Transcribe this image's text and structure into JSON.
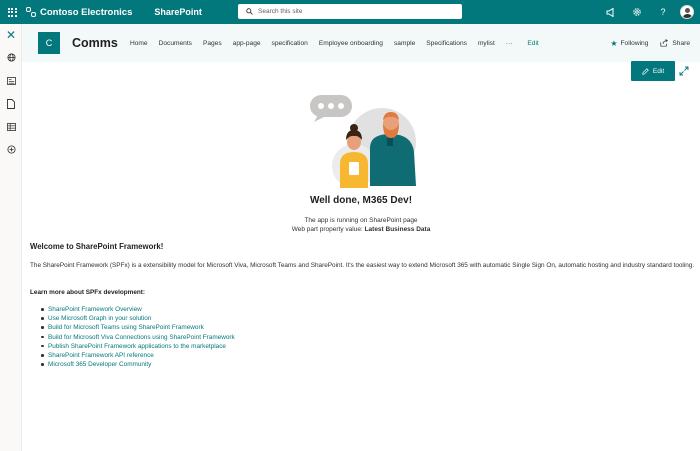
{
  "suite": {
    "org_name": "Contoso Electronics",
    "app_name": "SharePoint",
    "search_placeholder": "Search this site",
    "right_icons": [
      "megaphone-icon",
      "gear-icon",
      "help-icon"
    ],
    "help_glyph": "?"
  },
  "rail": {
    "items": [
      "close-icon",
      "globe-icon",
      "news-icon",
      "page-icon",
      "list-icon",
      "add-icon"
    ]
  },
  "site": {
    "logo_letter": "C",
    "title": "Comms",
    "nav": [
      "Home",
      "Documents",
      "Pages",
      "app-page",
      "specification",
      "Employee onboarding",
      "sample",
      "Specifications",
      "mylist"
    ],
    "more": "···",
    "edit_link": "Edit",
    "following": "Following",
    "share": "Share"
  },
  "command": {
    "edit_label": "Edit"
  },
  "webpart": {
    "greeting": "Well done, M365 Dev!",
    "env_line": "The app is running on SharePoint page",
    "prop_label": "Web part property value: ",
    "prop_value": "Latest Business Data",
    "welcome_heading": "Welcome to SharePoint Framework!",
    "description": "The SharePoint Framework (SPFx) is a extensibility model for Microsoft Viva, Microsoft Teams and SharePoint. It's the easiest way to extend Microsoft 365 with automatic Single Sign On, automatic hosting and industry standard tooling.",
    "learn_heading": "Learn more about SPFx development:",
    "links": [
      "SharePoint Framework Overview",
      "Use Microsoft Graph in your solution",
      "Build for Microsoft Teams using SharePoint Framework",
      "Build for Microsoft Viva Connections using SharePoint Framework",
      "Publish SharePoint Framework applications to the marketplace",
      "SharePoint Framework API reference",
      "Microsoft 365 Developer Community"
    ]
  },
  "colors": {
    "theme": "#03787c",
    "header_bg": "#f3f9f9",
    "illustration_yellow": "#f7b731",
    "illustration_teal": "#0f6c73",
    "illustration_orange": "#e07a3f",
    "illustration_gray": "#e1e1e1"
  }
}
